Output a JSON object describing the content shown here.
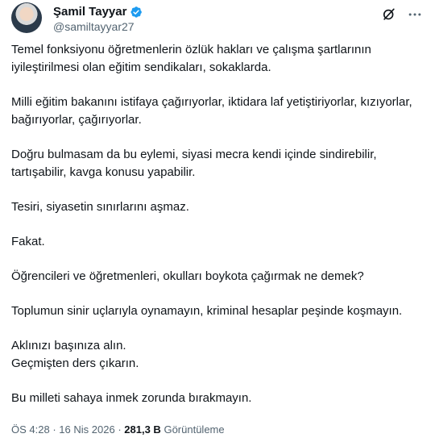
{
  "author": {
    "name": "Şamil Tayyar",
    "handle": "@samiltayyar27",
    "verified": true
  },
  "colors": {
    "verified_badge": "#1d9bf0",
    "muted_text": "#536471",
    "primary_text": "#0f1419"
  },
  "header_icons": [
    "grok-icon",
    "more-options-icon"
  ],
  "tweet": {
    "paragraphs": [
      "Temel fonksiyonu öğretmenlerin özlük hakları ve çalışma şartlarının iyileştirilmesi olan eğitim sendikaları, sokaklarda.",
      "Milli eğitim bakanını istifaya çağırıyorlar, iktidara laf yetiştiriyorlar, kızıyorlar, bağırıyorlar, çağırıyorlar.",
      "Doğru bulmasam da bu eylemi, siyasi mecra kendi içinde sindirebilir, tartışabilir, kavga konusu yapabilir.",
      "Tesiri, siyasetin sınırlarını aşmaz.",
      "Fakat.",
      "Öğrencileri ve öğretmenleri, okulları boykota çağırmak ne demek?",
      "Toplumun sinir uçlarıyla oynamayın, kriminal hesaplar peşinde koşmayın.",
      "Aklınızı başınıza alın.\nGeçmişten ders çıkarın.",
      "Bu milleti sahaya inmek zorunda bırakmayın."
    ]
  },
  "meta": {
    "time": "ÖS 4:28",
    "separator": "·",
    "date": "16 Nis 2026",
    "views_count": "281,3 B",
    "views_label": "Görüntüleme"
  }
}
